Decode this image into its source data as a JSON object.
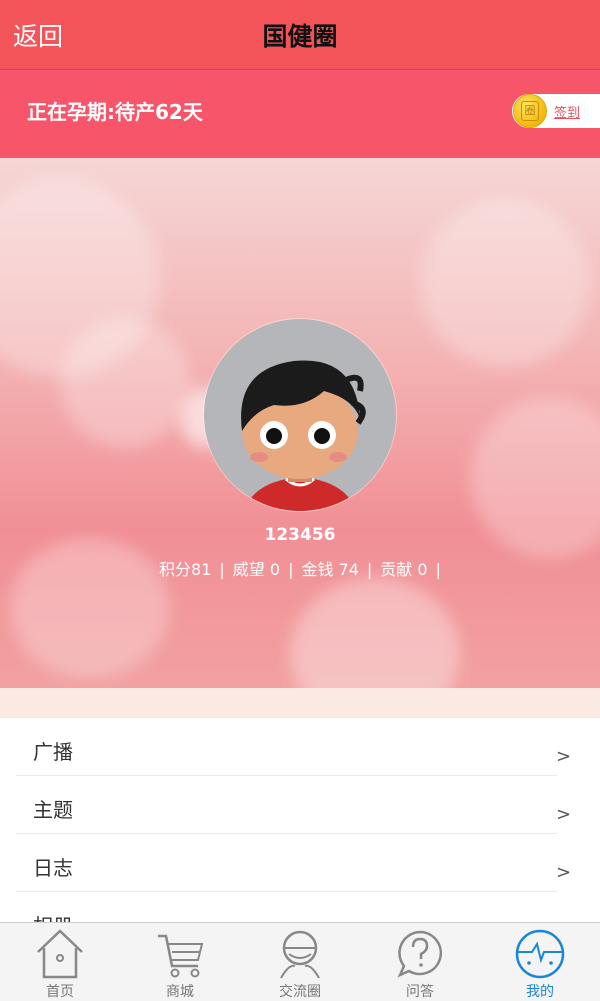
{
  "header": {
    "back_label": "返回",
    "title": "国健圈"
  },
  "pregnancy": {
    "status_text": "正在孕期:待产",
    "days": "62",
    "days_unit": "天",
    "signin_label": "签到",
    "coin_glyph": "圈"
  },
  "profile": {
    "username": "123456",
    "stats": [
      {
        "label": "积分81"
      },
      {
        "label": "威望 0"
      },
      {
        "label": "金钱 74"
      },
      {
        "label": "贡献 0"
      }
    ],
    "separator": "|"
  },
  "menu": {
    "items": [
      {
        "label": "广播",
        "arrow": ">"
      },
      {
        "label": "主题",
        "arrow": ">"
      },
      {
        "label": "日志",
        "arrow": ">"
      },
      {
        "label": "相册",
        "arrow": ">"
      }
    ]
  },
  "tabbar": {
    "tabs": [
      {
        "label": "首页",
        "icon": "home-icon"
      },
      {
        "label": "商城",
        "icon": "cart-icon"
      },
      {
        "label": "交流圈",
        "icon": "community-icon"
      },
      {
        "label": "问答",
        "icon": "question-icon"
      },
      {
        "label": "我的",
        "icon": "profile-icon"
      }
    ],
    "active_index": 4
  },
  "colors": {
    "header": "#f3545a",
    "pregnancy_bar": "#f7566a",
    "active_tab": "#1a86d6"
  }
}
